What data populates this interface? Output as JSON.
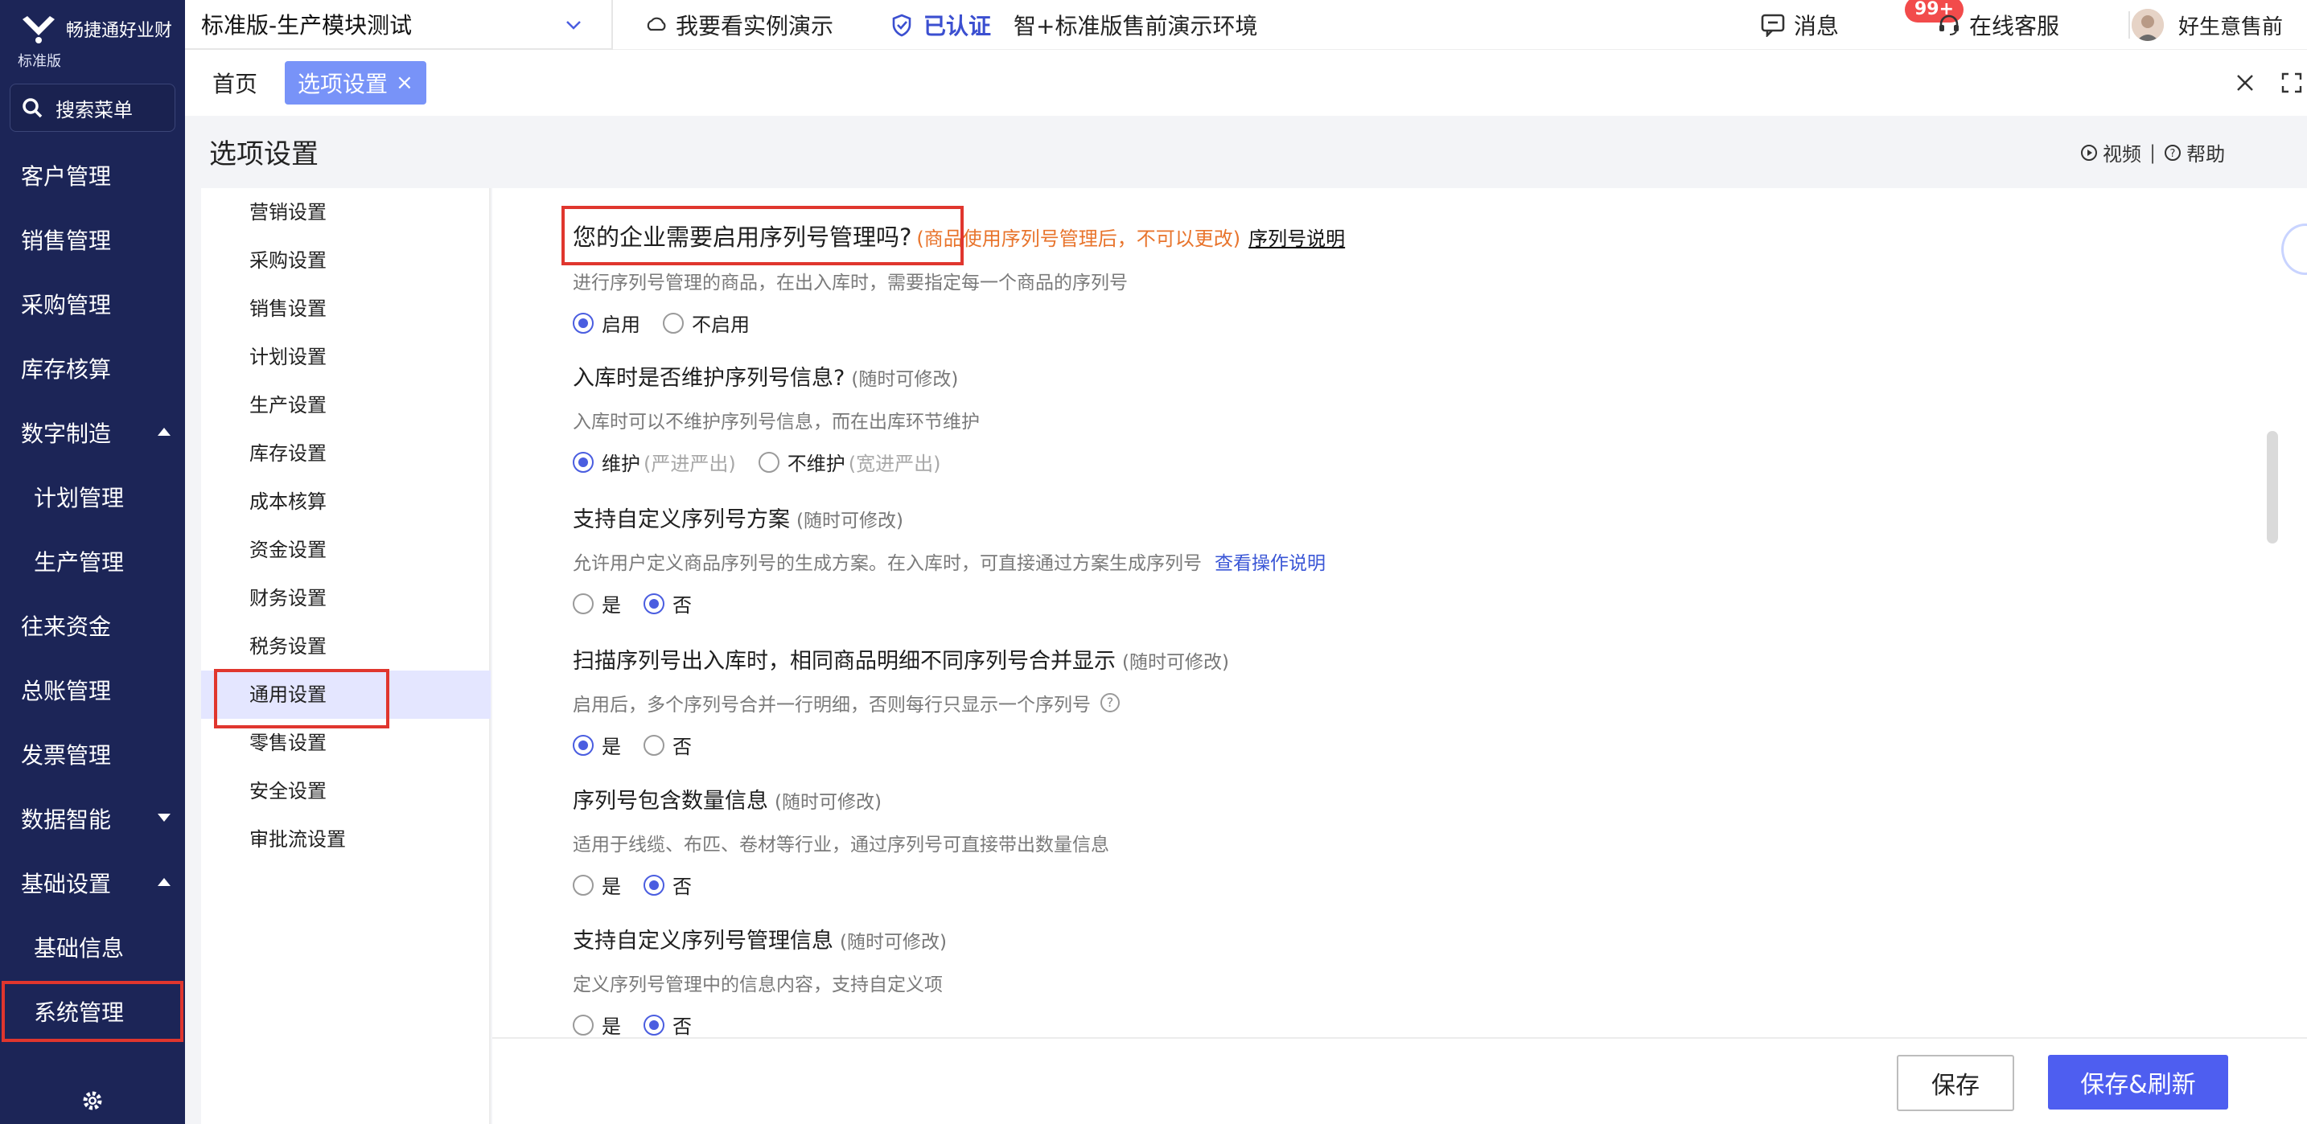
{
  "brand": {
    "name": "畅捷通好业财",
    "edition": "标准版"
  },
  "nav": {
    "search_label": "搜索菜单",
    "items": [
      {
        "label": "客户管理"
      },
      {
        "label": "销售管理"
      },
      {
        "label": "采购管理"
      },
      {
        "label": "库存核算"
      },
      {
        "label": "数字制造"
      },
      {
        "label": "计划管理"
      },
      {
        "label": "生产管理"
      },
      {
        "label": "往来资金"
      },
      {
        "label": "总账管理"
      },
      {
        "label": "发票管理"
      },
      {
        "label": "数据智能"
      },
      {
        "label": "基础设置"
      },
      {
        "label": "基础信息"
      },
      {
        "label": "系统管理"
      }
    ]
  },
  "topbar": {
    "account": "标准版-生产模块测试",
    "demo_link": "我要看实例演示",
    "verified": "已认证",
    "env_name": "智+标准版售前演示环境",
    "messages": "消息",
    "message_badge": "99+",
    "support": "在线客服",
    "user": "好生意售前"
  },
  "tabs": {
    "home": "首页",
    "active": "选项设置",
    "active_close": "×"
  },
  "page": {
    "title": "选项设置",
    "video_link": "视频",
    "help_link": "帮助",
    "help_sep": "|"
  },
  "settings_nav": [
    {
      "label": "营销设置"
    },
    {
      "label": "采购设置"
    },
    {
      "label": "销售设置"
    },
    {
      "label": "计划设置"
    },
    {
      "label": "生产设置"
    },
    {
      "label": "库存设置"
    },
    {
      "label": "成本核算"
    },
    {
      "label": "资金设置"
    },
    {
      "label": "财务设置"
    },
    {
      "label": "税务设置"
    },
    {
      "label": "通用设置"
    },
    {
      "label": "零售设置"
    },
    {
      "label": "安全设置"
    },
    {
      "label": "审批流设置"
    }
  ],
  "options": {
    "serial_enable": {
      "title": "您的企业需要启用序列号管理吗?",
      "warn": "(商品使用序列号管理后，不可以更改)",
      "link": "序列号说明",
      "desc": "进行序列号管理的商品，在出入库时，需要指定每一个商品的序列号",
      "opt1": "启用",
      "opt2": "不启用"
    },
    "maintain_on_inbound": {
      "title": "入库时是否维护序列号信息?",
      "note": "(随时可修改)",
      "desc": "入库时可以不维护序列号信息，而在出库环节维护",
      "opt1": "维护",
      "opt1_hint": "(严进严出)",
      "opt2": "不维护",
      "opt2_hint": "(宽进严出)"
    },
    "custom_scheme": {
      "title": "支持自定义序列号方案",
      "note": "(随时可修改)",
      "desc": "允许用户定义商品序列号的生成方案。在入库时，可直接通过方案生成序列号",
      "link": "查看操作说明",
      "opt1": "是",
      "opt2": "否"
    },
    "merge_display": {
      "title": "扫描序列号出入库时，相同商品明细不同序列号合并显示",
      "note": "(随时可修改)",
      "desc": "启用后，多个序列号合并一行明细，否则每行只显示一个序列号",
      "help": "?",
      "opt1": "是",
      "opt2": "否"
    },
    "qty_info": {
      "title": "序列号包含数量信息",
      "note": "(随时可修改)",
      "desc": "适用于线缆、布匹、卷材等行业，通过序列号可直接带出数量信息",
      "opt1": "是",
      "opt2": "否"
    },
    "custom_info": {
      "title": "支持自定义序列号管理信息",
      "note": "(随时可修改)",
      "desc": "定义序列号管理中的信息内容，支持自定义项",
      "opt1": "是",
      "opt2": "否"
    }
  },
  "footer": {
    "save": "保存",
    "save_refresh": "保存&刷新"
  },
  "colors": {
    "nav_bg": "#1c2557",
    "accent": "#4e5ef0",
    "tab_active": "#7893f8",
    "highlight_box": "#e0362e",
    "warn": "#e8742c"
  }
}
